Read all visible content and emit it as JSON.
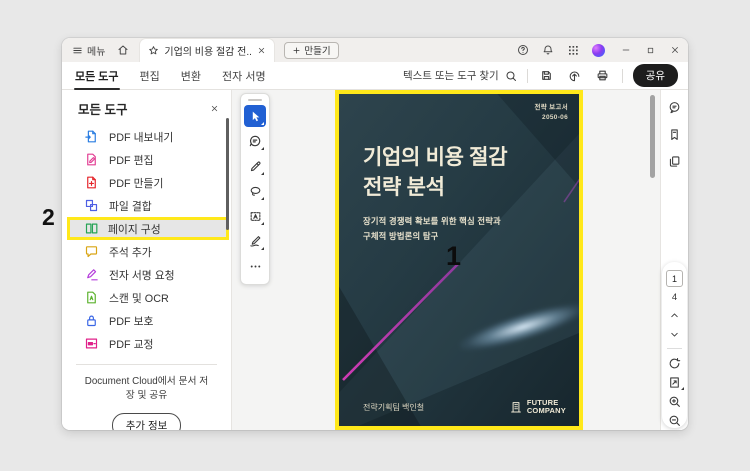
{
  "titlebar": {
    "menu_label": "메뉴",
    "tab_title": "기업의 비용 절감 전...",
    "create_label": "만들기"
  },
  "toolbar": {
    "tabs": [
      {
        "label": "모든 도구",
        "active": true
      },
      {
        "label": "편집",
        "active": false
      },
      {
        "label": "변환",
        "active": false
      },
      {
        "label": "전자 서명",
        "active": false
      }
    ],
    "search_label": "텍스트 또는 도구 찾기",
    "share_label": "공유",
    "icons": [
      "save-icon",
      "upload-icon",
      "print-icon"
    ]
  },
  "sidebar": {
    "title": "모든 도구",
    "items": [
      {
        "label": "PDF 내보내기",
        "icon": "export-pdf-icon",
        "color": "#2a7de1",
        "highlighted": false
      },
      {
        "label": "PDF 편집",
        "icon": "edit-pdf-icon",
        "color": "#e23f94",
        "highlighted": false
      },
      {
        "label": "PDF 만들기",
        "icon": "create-pdf-icon",
        "color": "#e5252a",
        "highlighted": false
      },
      {
        "label": "파일 결합",
        "icon": "combine-files-icon",
        "color": "#4e5fe4",
        "highlighted": false
      },
      {
        "label": "페이지 구성",
        "icon": "organize-pages-icon",
        "color": "#27a356",
        "highlighted": true
      },
      {
        "label": "주석 추가",
        "icon": "add-comments-icon",
        "color": "#d9a514",
        "highlighted": false
      },
      {
        "label": "전자 서명 요청",
        "icon": "request-esign-icon",
        "color": "#b53ddb",
        "highlighted": false
      },
      {
        "label": "스캔 및 OCR",
        "icon": "scan-ocr-icon",
        "color": "#5cb22e",
        "highlighted": false
      },
      {
        "label": "PDF 보호",
        "icon": "protect-pdf-icon",
        "color": "#3a66e5",
        "highlighted": false
      },
      {
        "label": "PDF 교정",
        "icon": "redact-pdf-icon",
        "color": "#e0218a",
        "highlighted": false
      }
    ],
    "footer_text": "Document Cloud에서 문서 저장 및 공유",
    "more_info_label": "추가 정보"
  },
  "quick_tools": [
    "select-tool",
    "add-comment-tool",
    "draw-tool",
    "lasso-tool",
    "text-box-tool",
    "fill-sign-tool",
    "more-tools"
  ],
  "right_rail_panels": [
    "comments-panel",
    "bookmarks-panel",
    "page-thumbnails-panel"
  ],
  "document": {
    "report_label": "전략 보고서",
    "report_number": "2050-06",
    "title_line1": "기업의 비용 절감",
    "title_line2": "전략 분석",
    "subtitle_line1": "장기적 경쟁력 확보를 위한 핵심 전략과",
    "subtitle_line2": "구체적 방법론의 탐구",
    "author": "전략기획팀 백인철",
    "company_name_line1": "FUTURE",
    "company_name_line2": "COMPANY"
  },
  "annotations": {
    "callout_1": "1",
    "callout_2": "2"
  },
  "page_controls": {
    "current_page": "1",
    "total_pages": "4"
  },
  "colors": {
    "highlight_yellow": "#ffe81a",
    "accent_blue": "#2160d3",
    "share_black": "#1d1d1d",
    "cover_text": "#f1ebd7",
    "callout_line_top": "#8e3a9e",
    "callout_line_bottom": "#cf3bb4"
  }
}
